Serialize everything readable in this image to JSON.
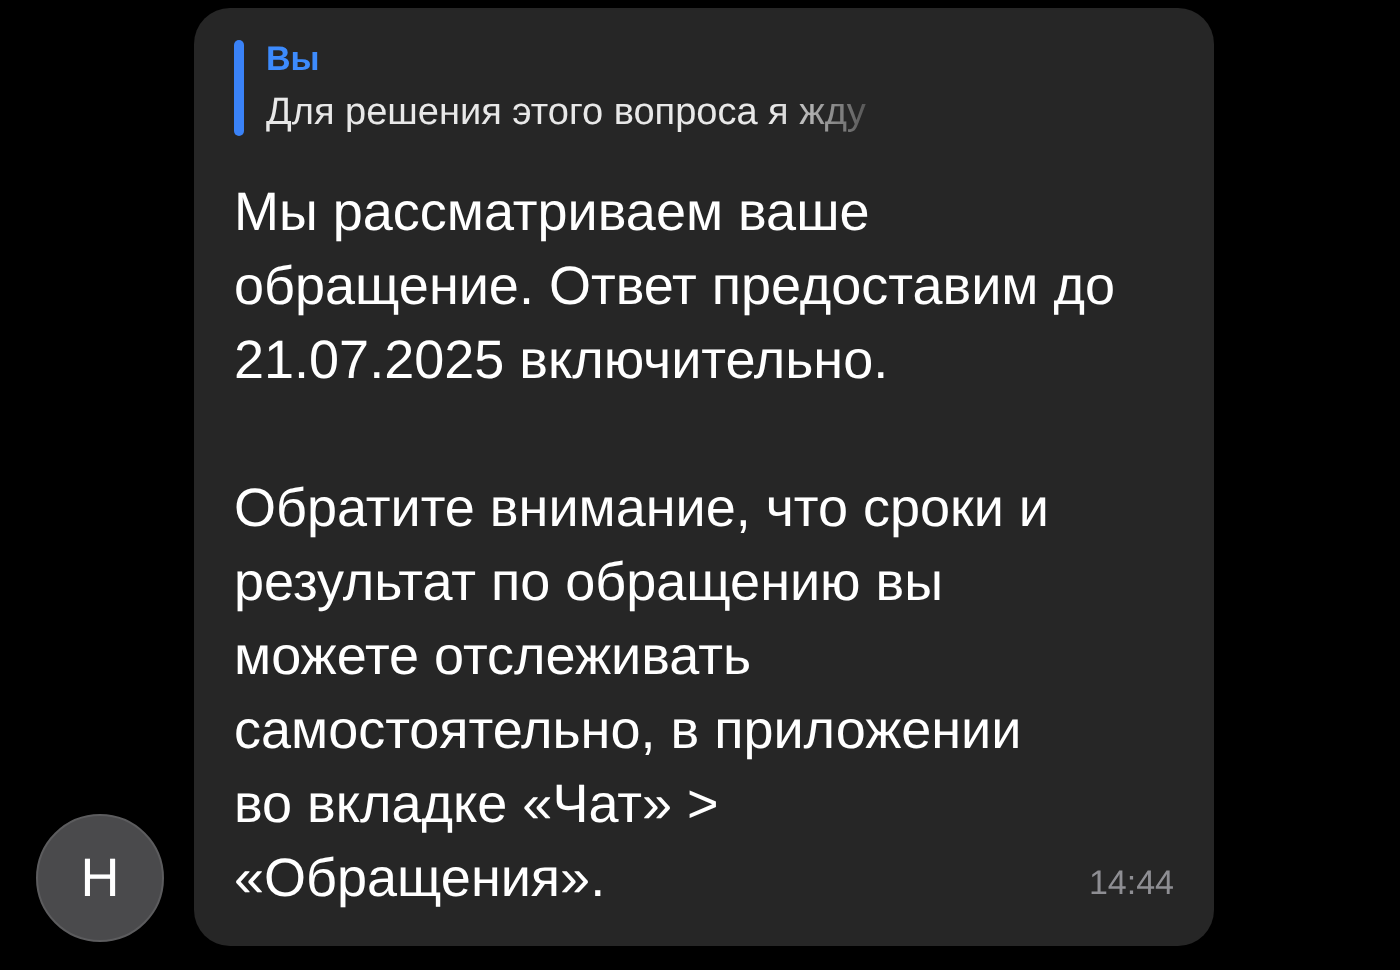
{
  "avatar": {
    "initial": "Н"
  },
  "message": {
    "reply": {
      "author": "Вы",
      "text": "Для решения этого вопроса я жду"
    },
    "paragraphs": [
      "Мы рассматриваем ваше обращение. Ответ предоставим до 21.07.2025 включительно.",
      "Обратите внимание, что сроки и результат по обращению вы можете отслеживать самостоятельно, в приложении во вкладке «Чат» > «Обращения»."
    ],
    "time": "14:44"
  }
}
